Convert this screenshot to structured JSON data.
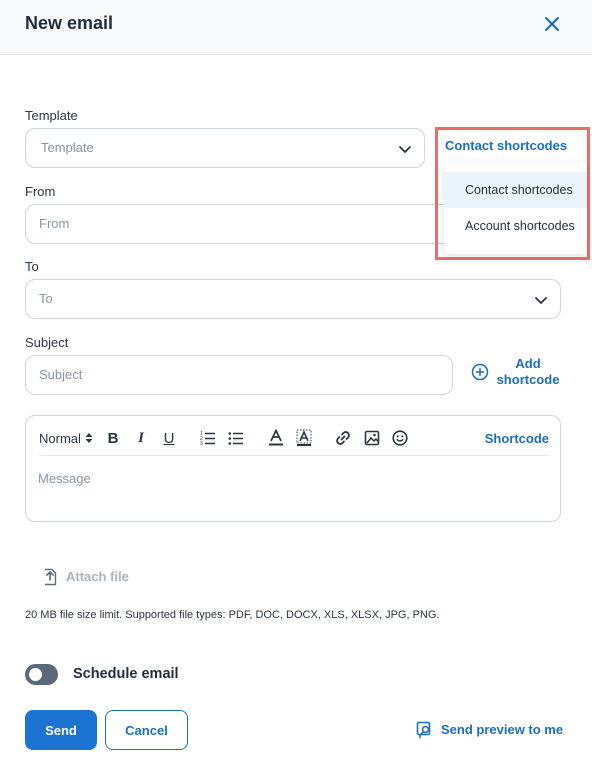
{
  "header": {
    "title": "New email"
  },
  "template": {
    "label": "Template",
    "placeholder": "Template"
  },
  "from": {
    "label": "From",
    "placeholder": "From"
  },
  "to": {
    "label": "To",
    "placeholder": "To"
  },
  "subject": {
    "label": "Subject",
    "placeholder": "Subject"
  },
  "shortcode_dropdown": {
    "trigger_label": "Contact shortcodes",
    "options": [
      {
        "label": "Contact shortcodes",
        "selected": true
      },
      {
        "label": "Account shortcodes",
        "selected": false
      }
    ]
  },
  "add_shortcode": {
    "line1": "Add",
    "line2": "shortcode"
  },
  "editor": {
    "format_label": "Normal",
    "toolbar_icons": [
      "bold-icon",
      "italic-icon",
      "underline-icon",
      "ordered-list-icon",
      "bullet-list-icon",
      "text-color-icon",
      "highlight-icon",
      "link-icon",
      "image-icon",
      "emoji-icon"
    ],
    "bold_label": "B",
    "italic_label": "I",
    "underline_label": "U",
    "shortcode_label": "Shortcode",
    "message_placeholder": "Message"
  },
  "attach": {
    "label": "Attach file"
  },
  "file_limit": "20 MB file size limit. Supported file types: PDF, DOC, DOCX, XLS, XLSX, JPG, PNG.",
  "schedule": {
    "label": "Schedule email",
    "enabled": false
  },
  "footer": {
    "send_label": "Send",
    "cancel_label": "Cancel",
    "preview_label": "Send preview to me"
  },
  "colors": {
    "accent": "#1b6ec2",
    "send_button": "#1b74d2",
    "highlight_frame": "#ef6b6b",
    "toggle_off": "#59697b"
  }
}
